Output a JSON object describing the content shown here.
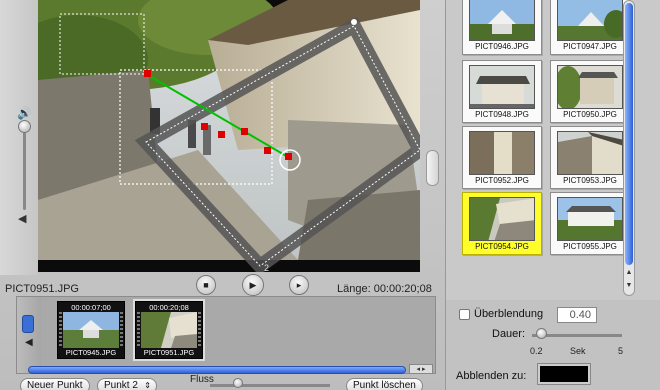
{
  "viewer": {
    "clip_name": "PICT0951.JPG",
    "duration_label": "Länge: 00:00:20;08",
    "frame_counter": "2"
  },
  "transport": {
    "stop_glyph": "■",
    "play_glyph": "▶",
    "end_glyph": "▸"
  },
  "timeline": {
    "clips": [
      {
        "time": "00:00:07;00",
        "name": "PICT0945.JPG",
        "selected": false
      },
      {
        "time": "00:00:20;08",
        "name": "PICT0951.JPG",
        "selected": true
      }
    ],
    "side_icon": "speaker-icon"
  },
  "bottom": {
    "new_point": "Neuer Punkt",
    "point_menu": "Punkt 2",
    "flow_label": "Fluss",
    "delete_point": "Punkt löschen"
  },
  "browser": {
    "thumbnails": [
      {
        "name": "PICT0946.JPG",
        "highlighted": false
      },
      {
        "name": "PICT0947.JPG",
        "highlighted": false
      },
      {
        "name": "PICT0948.JPG",
        "highlighted": false
      },
      {
        "name": "PICT0950.JPG",
        "highlighted": false
      },
      {
        "name": "PICT0952.JPG",
        "highlighted": false
      },
      {
        "name": "PICT0953.JPG",
        "highlighted": false
      },
      {
        "name": "PICT0954.JPG",
        "highlighted": true
      },
      {
        "name": "PICT0955.JPG",
        "highlighted": false
      }
    ]
  },
  "settings": {
    "crossfade_label": "Überblendung",
    "crossfade_checked": false,
    "crossfade_value": "0.40",
    "duration_label": "Dauer:",
    "scale_min": "0.2",
    "scale_unit": "Sek",
    "scale_max": "5",
    "fade_to_label": "Abblenden zu:",
    "fade_color": "#000000"
  },
  "colors": {
    "highlight": "#fffd2a",
    "accent": "#2d62d8",
    "path_line": "#00c000",
    "keypoint": "#e00000"
  }
}
